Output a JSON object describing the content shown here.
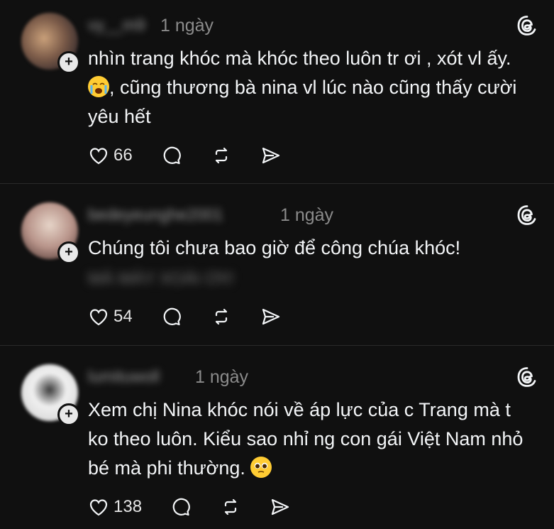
{
  "comments": [
    {
      "username": "vy__m9",
      "time": "1 ngày",
      "text_before_emoji": "nhìn trang khóc mà khóc theo luôn tr ơi , xót vl ấy. ",
      "emoji": "crying-face",
      "text_after_emoji": ", cũng thương bà nina vl lúc nào cũng thấy cười yêu hết",
      "likes": "66"
    },
    {
      "username": "bedeyeunghe2001",
      "time": "1 ngày",
      "text": "Chúng tôi chưa bao giờ để công chúa khóc!",
      "hidden_line": "MÁ MÀY XOÀI ƠI!!",
      "likes": "54"
    },
    {
      "username": "lumituwoll",
      "time": "1 ngày",
      "text_before_emoji": "Xem chị Nina khóc nói về áp lực của c Trang mà t ko theo luôn. Kiểu sao nhỉ ng con gái Việt Nam nhỏ bé mà phi thường. ",
      "emoji": "pleading-face",
      "likes": "138"
    }
  ],
  "colors": {
    "background": "#101010",
    "text": "#f3f5f7",
    "muted": "#8b8b8b",
    "divider": "#2a2a2a"
  },
  "icons": [
    "threads-logo-icon",
    "heart-icon",
    "comment-icon",
    "repost-icon",
    "share-icon",
    "crying-face-emoji",
    "pleading-face-emoji",
    "follow-plus-icon"
  ]
}
